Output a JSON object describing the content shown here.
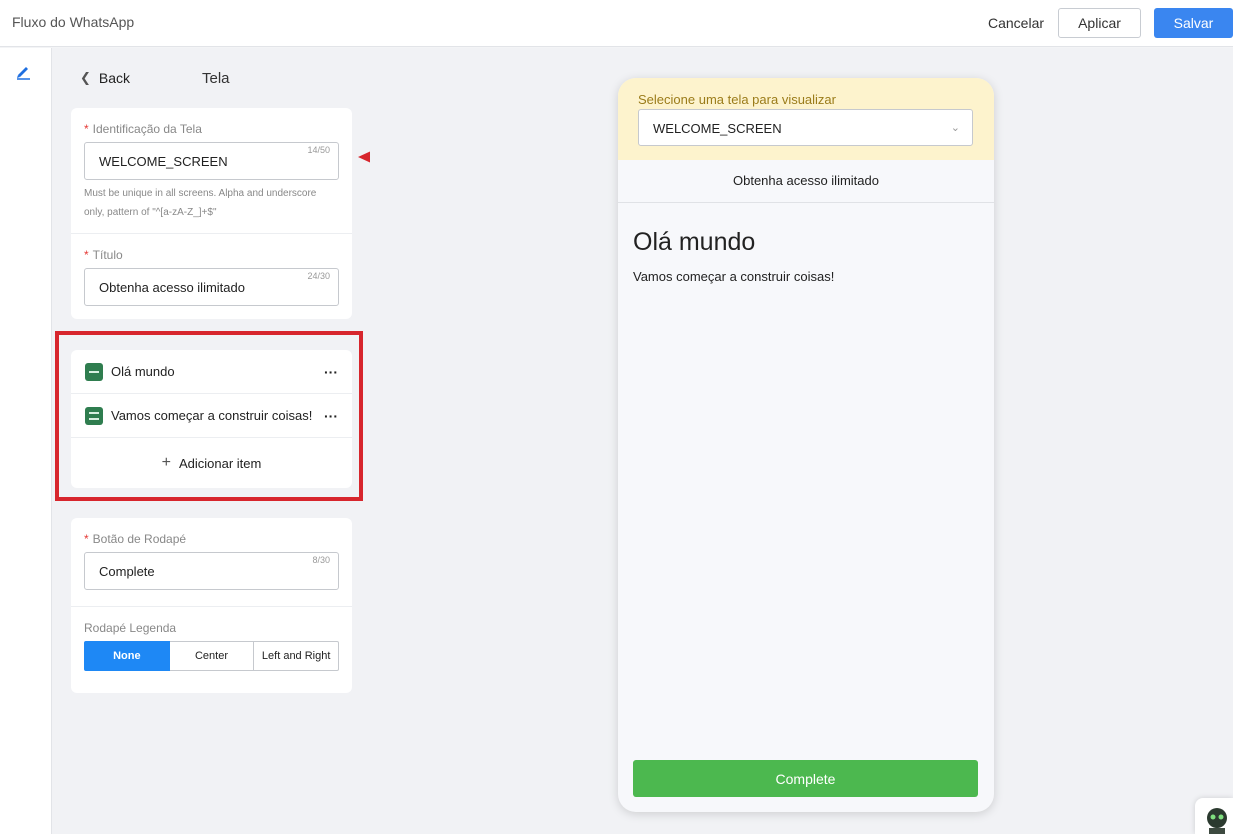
{
  "app": {
    "title": "Fluxo do WhatsApp"
  },
  "toolbar": {
    "cancel_label": "Cancelar",
    "apply_label": "Aplicar",
    "save_label": "Salvar"
  },
  "panel": {
    "back_label": "Back",
    "title": "Tela",
    "screen_id": {
      "label": "Identificação da Tela",
      "value": "WELCOME_SCREEN",
      "counter": "14/50",
      "hint": "Must be unique in all screens. Alpha and underscore only, pattern of \"^[a-zA-Z_]+$\""
    },
    "title_field": {
      "label": "Título",
      "value": "Obtenha acesso ilimitado",
      "counter": "24/30"
    },
    "items": [
      {
        "label": "Olá mundo",
        "icon": "heading-icon"
      },
      {
        "label": "Vamos começar a construir coisas!",
        "icon": "paragraph-icon"
      }
    ],
    "add_item_label": "Adicionar item",
    "footer_button": {
      "label": "Botão de Rodapé",
      "value": "Complete",
      "counter": "8/30"
    },
    "footer_caption": {
      "label": "Rodapé Legenda",
      "options": [
        "None",
        "Center",
        "Left and Right"
      ],
      "selected": "None"
    }
  },
  "preview": {
    "select_label": "Selecione uma tela para visualizar",
    "selected_screen": "WELCOME_SCREEN",
    "header": "Obtenha acesso ilimitado",
    "heading": "Olá mundo",
    "body": "Vamos começar a construir coisas!",
    "button_label": "Complete"
  },
  "colors": {
    "primary": "#3a86f0",
    "segment_active": "#1e88f5",
    "complete_button": "#4cb84f",
    "annotation": "#d7262d",
    "select_bar": "#fdf3cd"
  }
}
